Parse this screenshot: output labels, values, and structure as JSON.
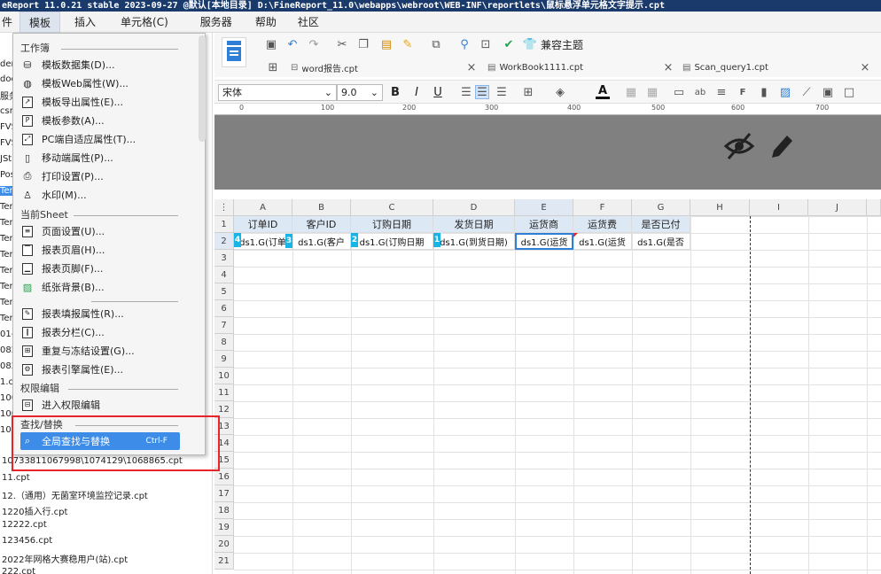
{
  "titlebar": {
    "text": "eReport 11.0.21 stable 2023-09-27 @默认[本地目录]    D:\\FineReport_11.0\\webapps\\webroot\\WEB-INF\\reportlets\\鼠标悬浮单元格文字提示.cpt"
  },
  "menubar": {
    "items": [
      "件",
      "模板",
      "插入",
      "单元格(C)",
      "服务器",
      "帮助",
      "社区"
    ]
  },
  "lefttree": {
    "items": [
      "dem",
      "doc",
      "服务",
      "csm",
      "FVS",
      "FVS",
      "JSt",
      "Pos",
      "Tem",
      "Tem",
      "Tem",
      "Tem",
      "Tem",
      "Tem",
      "Tem",
      "Tem",
      "Tem",
      "01-",
      "082",
      "082",
      "1.c",
      "100",
      "100",
      "100"
    ],
    "bottom_items": [
      "10733811067998\\1074129\\1068865.cpt",
      "11.cpt",
      "12.（通用）无菌室环境监控记录.cpt",
      "1220插入行.cpt",
      "12222.cpt",
      "123456.cpt",
      "2022年网格大赛稳用户(站).cpt",
      "222.cpt"
    ]
  },
  "menu": {
    "sections": [
      {
        "title": "工作簿",
        "items": [
          {
            "icon": "database-icon",
            "label": "模板数据集(D)..."
          },
          {
            "icon": "globe-icon",
            "label": "模板Web属性(W)..."
          },
          {
            "icon": "export-icon",
            "label": "模板导出属性(E)..."
          },
          {
            "icon": "param-icon",
            "label": "模板参数(A)..."
          },
          {
            "icon": "adapt-icon",
            "label": "PC端自适应属性(T)..."
          },
          {
            "icon": "mobile-icon",
            "label": "移动端属性(P)..."
          },
          {
            "icon": "print-icon",
            "label": "打印设置(P)..."
          },
          {
            "icon": "stamp-icon",
            "label": "水印(M)..."
          }
        ]
      },
      {
        "title": "当前Sheet",
        "items": [
          {
            "icon": "page-icon",
            "label": "页面设置(U)..."
          },
          {
            "icon": "header-icon",
            "label": "报表页眉(H)..."
          },
          {
            "icon": "footer-icon",
            "label": "报表页脚(F)..."
          },
          {
            "icon": "image-icon",
            "label": "纸张背景(B)..."
          },
          {
            "icon": "fill-icon",
            "label": "报表填报属性(R)..."
          },
          {
            "icon": "column-icon",
            "label": "报表分栏(C)..."
          },
          {
            "icon": "freeze-icon",
            "label": "重复与冻结设置(G)..."
          },
          {
            "icon": "engine-icon",
            "label": "报表引擎属性(E)..."
          }
        ]
      },
      {
        "title": "权限编辑",
        "items": [
          {
            "icon": "permission-icon",
            "label": "进入权限编辑"
          }
        ]
      },
      {
        "title": "查找/替换",
        "items": [
          {
            "icon": "search-icon",
            "label": "全局查找与替换",
            "shortcut": "Ctrl-F"
          }
        ]
      }
    ]
  },
  "tabs": [
    {
      "label": "word报告.cpt"
    },
    {
      "label": "WorkBook1111.cpt"
    },
    {
      "label": "Scan_query1.cpt"
    }
  ],
  "toolbar": {
    "compat_label": "兼容主题"
  },
  "format": {
    "font": "宋体",
    "size": "9.0"
  },
  "ruler": {
    "ticks": [
      "0",
      "100",
      "200",
      "300",
      "400",
      "500",
      "600",
      "700"
    ]
  },
  "sheet": {
    "columns": [
      "A",
      "B",
      "C",
      "D",
      "E",
      "F",
      "G",
      "H",
      "I",
      "J"
    ],
    "rows": [
      "1",
      "2",
      "3",
      "4",
      "5",
      "6",
      "7",
      "8",
      "9",
      "10",
      "11",
      "12",
      "13",
      "14",
      "15",
      "16",
      "17",
      "18",
      "19",
      "20",
      "21"
    ],
    "headers": [
      "订单ID",
      "客户ID",
      "订购日期",
      "发货日期",
      "运货商",
      "运货费",
      "是否已付"
    ],
    "data": [
      "ds1.G(订单",
      "ds1.G(客户",
      "ds1.G(订购日期",
      "ds1.G(到货日期)",
      "ds1.G(运货",
      "ds1.G(运货",
      "ds1.G(是否"
    ],
    "markers": [
      "4",
      "3",
      "2",
      "1"
    ]
  },
  "colors": {
    "accent": "#3d8ce7",
    "redbox": "#e8232a",
    "header_bg": "#808080",
    "titlebar": "#1a3a6b"
  }
}
